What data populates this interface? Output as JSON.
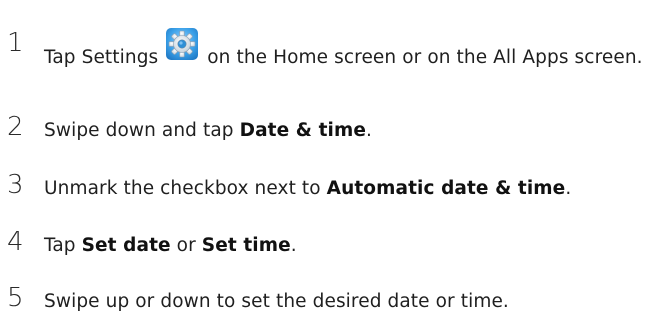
{
  "steps": [
    {
      "number": "1",
      "parts": {
        "before_icon": "Tap Settings",
        "after_icon": "on the Home screen or on the All Apps screen."
      },
      "icon": "settings-gear-icon"
    },
    {
      "number": "2",
      "parts": {
        "before_bold": "Swipe down and tap ",
        "bold": "Date & time",
        "after_bold": "."
      }
    },
    {
      "number": "3",
      "parts": {
        "before_bold": "Unmark the checkbox next to ",
        "bold": "Automatic date & time",
        "after_bold": "."
      }
    },
    {
      "number": "4",
      "parts": {
        "before_bold1": "Tap ",
        "bold1": "Set date",
        "middle": " or ",
        "bold2": "Set time",
        "after_bold2": "."
      }
    },
    {
      "number": "5",
      "parts": {
        "text": "Swipe up or down to set the desired date or time."
      }
    }
  ],
  "colors": {
    "text": "#1f1f1f",
    "icon_blue": "#3aa0e8",
    "icon_gear": "#f0f4f8"
  }
}
